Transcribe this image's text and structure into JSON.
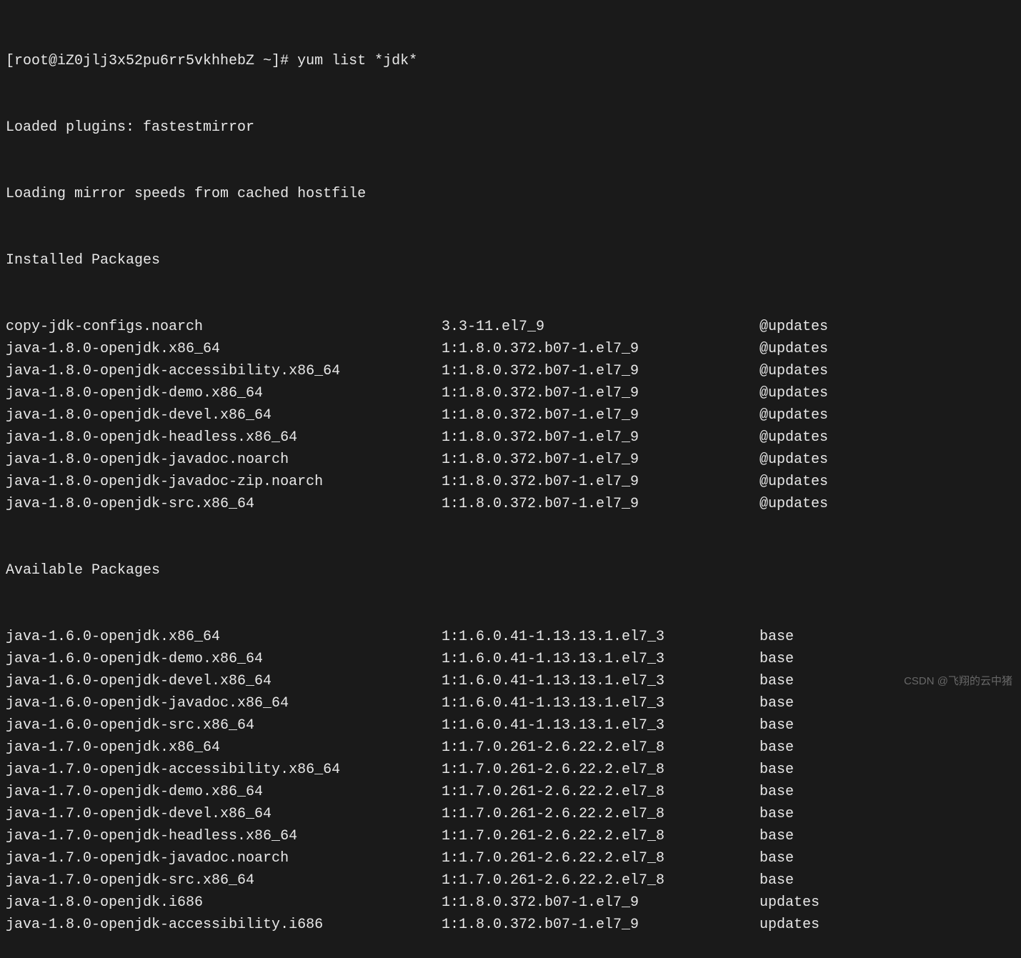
{
  "prompt": {
    "prefix": "[root@iZ0jlj3x52pu6rr5vkhhebZ ~]# ",
    "command": "yum list *jdk*"
  },
  "messages": {
    "loaded_plugins": "Loaded plugins: fastestmirror",
    "loading_mirror": "Loading mirror speeds from cached hostfile"
  },
  "sections": {
    "installed_header": "Installed Packages",
    "available_header": "Available Packages"
  },
  "installed": [
    {
      "name": "copy-jdk-configs.noarch",
      "version": "3.3-11.el7_9",
      "repo": "@updates"
    },
    {
      "name": "java-1.8.0-openjdk.x86_64",
      "version": "1:1.8.0.372.b07-1.el7_9",
      "repo": "@updates"
    },
    {
      "name": "java-1.8.0-openjdk-accessibility.x86_64",
      "version": "1:1.8.0.372.b07-1.el7_9",
      "repo": "@updates"
    },
    {
      "name": "java-1.8.0-openjdk-demo.x86_64",
      "version": "1:1.8.0.372.b07-1.el7_9",
      "repo": "@updates"
    },
    {
      "name": "java-1.8.0-openjdk-devel.x86_64",
      "version": "1:1.8.0.372.b07-1.el7_9",
      "repo": "@updates"
    },
    {
      "name": "java-1.8.0-openjdk-headless.x86_64",
      "version": "1:1.8.0.372.b07-1.el7_9",
      "repo": "@updates"
    },
    {
      "name": "java-1.8.0-openjdk-javadoc.noarch",
      "version": "1:1.8.0.372.b07-1.el7_9",
      "repo": "@updates"
    },
    {
      "name": "java-1.8.0-openjdk-javadoc-zip.noarch",
      "version": "1:1.8.0.372.b07-1.el7_9",
      "repo": "@updates"
    },
    {
      "name": "java-1.8.0-openjdk-src.x86_64",
      "version": "1:1.8.0.372.b07-1.el7_9",
      "repo": "@updates"
    }
  ],
  "available": [
    {
      "name": "java-1.6.0-openjdk.x86_64",
      "version": "1:1.6.0.41-1.13.13.1.el7_3",
      "repo": "base"
    },
    {
      "name": "java-1.6.0-openjdk-demo.x86_64",
      "version": "1:1.6.0.41-1.13.13.1.el7_3",
      "repo": "base"
    },
    {
      "name": "java-1.6.0-openjdk-devel.x86_64",
      "version": "1:1.6.0.41-1.13.13.1.el7_3",
      "repo": "base"
    },
    {
      "name": "java-1.6.0-openjdk-javadoc.x86_64",
      "version": "1:1.6.0.41-1.13.13.1.el7_3",
      "repo": "base"
    },
    {
      "name": "java-1.6.0-openjdk-src.x86_64",
      "version": "1:1.6.0.41-1.13.13.1.el7_3",
      "repo": "base"
    },
    {
      "name": "java-1.7.0-openjdk.x86_64",
      "version": "1:1.7.0.261-2.6.22.2.el7_8",
      "repo": "base"
    },
    {
      "name": "java-1.7.0-openjdk-accessibility.x86_64",
      "version": "1:1.7.0.261-2.6.22.2.el7_8",
      "repo": "base"
    },
    {
      "name": "java-1.7.0-openjdk-demo.x86_64",
      "version": "1:1.7.0.261-2.6.22.2.el7_8",
      "repo": "base"
    },
    {
      "name": "java-1.7.0-openjdk-devel.x86_64",
      "version": "1:1.7.0.261-2.6.22.2.el7_8",
      "repo": "base"
    },
    {
      "name": "java-1.7.0-openjdk-headless.x86_64",
      "version": "1:1.7.0.261-2.6.22.2.el7_8",
      "repo": "base"
    },
    {
      "name": "java-1.7.0-openjdk-javadoc.noarch",
      "version": "1:1.7.0.261-2.6.22.2.el7_8",
      "repo": "base"
    },
    {
      "name": "java-1.7.0-openjdk-src.x86_64",
      "version": "1:1.7.0.261-2.6.22.2.el7_8",
      "repo": "base"
    },
    {
      "name": "java-1.8.0-openjdk.i686",
      "version": "1:1.8.0.372.b07-1.el7_9",
      "repo": "updates"
    },
    {
      "name": "java-1.8.0-openjdk-accessibility.i686",
      "version": "1:1.8.0.372.b07-1.el7_9",
      "repo": "updates"
    }
  ],
  "watermark": "CSDN @飞翔的云中猪"
}
